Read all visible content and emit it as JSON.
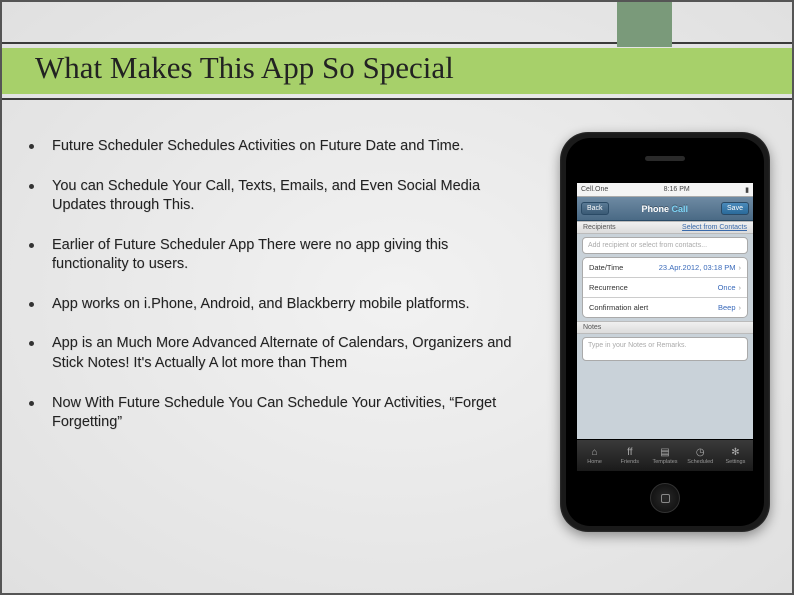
{
  "slide": {
    "title": "What Makes This App So Special",
    "bullets": [
      "Future Scheduler Schedules Activities on Future Date and Time.",
      "You can Schedule Your Call, Texts, Emails, and Even Social Media Updates through This.",
      "Earlier of Future Scheduler App There were no app giving this functionality to users.",
      "App works on i.Phone, Android, and Blackberry mobile platforms.",
      "App is an Much More Advanced Alternate of Calendars, Organizers and Stick Notes! It's Actually A lot more than  Them",
      "Now With Future Schedule You Can Schedule Your Activities, “Forget Forgetting”"
    ]
  },
  "phone": {
    "carrier": "Cell.One",
    "time": "8:16 PM",
    "nav": {
      "back": "Back",
      "title_a": "Phone",
      "title_b": "Call",
      "save": "Save"
    },
    "recipients": {
      "header": "Recipients",
      "link": "Select from Contacts",
      "placeholder": "Add recipient or select from contacts..."
    },
    "rows": {
      "datetime_label": "Date/Time",
      "datetime_value": "23.Apr.2012, 03:18 PM",
      "recurrence_label": "Recurrence",
      "recurrence_value": "Once",
      "confirm_label": "Confirmation alert",
      "confirm_value": "Beep"
    },
    "notes": {
      "header": "Notes",
      "placeholder": "Type in your Notes or Remarks."
    },
    "tabs": [
      "Home",
      "Friends",
      "Templates",
      "Scheduled",
      "Settings"
    ]
  }
}
